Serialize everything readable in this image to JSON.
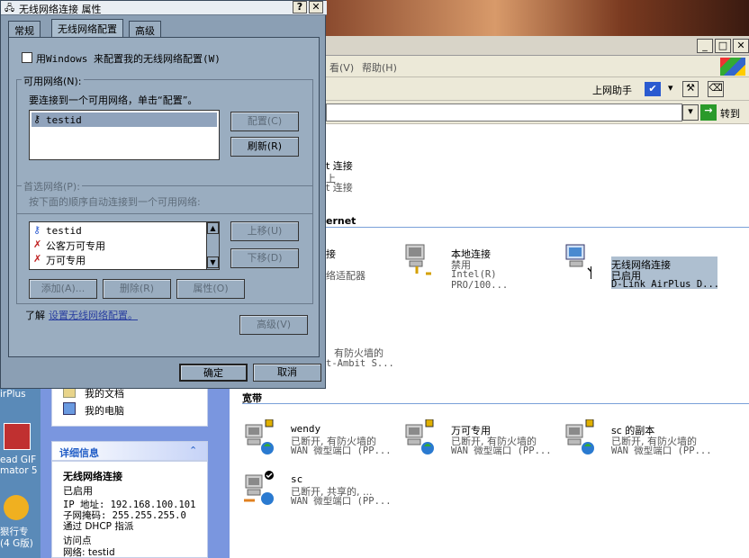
{
  "explorer": {
    "menu_help": "帮助(H)",
    "menu_view_fragment": "看(V)",
    "toolbar_helper": "上网助手",
    "go_label": "转到",
    "conn_fragment_title": "t 连接",
    "conn_fragment_line2": "上",
    "conn_fragment_line3": "t 连接",
    "section_internet": "ernet",
    "conn_fragment2_title": "接",
    "conn_fragment2_sub": "络适配器",
    "local": {
      "name": "本地连接",
      "status": "禁用",
      "device": "Intel(R) PRO/100..."
    },
    "wireless": {
      "name": "无线网络连接",
      "status": "已启用",
      "device": "D-Link AirPlus D..."
    },
    "firewall_frag": {
      "line1": "有防火墙的",
      "line2": "t-Ambit S..."
    },
    "section_broadband": "宽带",
    "broadband": [
      {
        "name": "wendy",
        "status": "已断开, 有防火墙的",
        "device": "WAN 微型端口 (PP..."
      },
      {
        "name": "万可专用",
        "status": "已断开, 有防火墙的",
        "device": "WAN 微型端口 (PP..."
      },
      {
        "name": "sc 的副本",
        "status": "已断开, 有防火墙的",
        "device": "WAN 微型端口 (PP..."
      },
      {
        "name": "sc",
        "status": "已断开, 共享的, ...",
        "device": "WAN 微型端口 (PP..."
      }
    ],
    "left_items": [
      "我的文档",
      "我的电脑"
    ],
    "details_title": "详细信息",
    "details": {
      "name": "无线网络连接",
      "status": "已启用",
      "ip": "IP 地址: 192.168.100.101",
      "mask": "子网掩码: 255.255.255.0",
      "dhcp": "通过 DHCP 指派",
      "ap": "访问点",
      "net": "网络: testid"
    },
    "desktop": {
      "a": "irPlus",
      "b": "ead GIF",
      "c": "mator 5",
      "d": "狠行专",
      "e": "(4 G版)"
    }
  },
  "dialog": {
    "title": "无线网络连接 属性",
    "tabs": [
      "常规",
      "无线网络配置",
      "高级"
    ],
    "use_windows": "用Windows 来配置我的无线网络配置(W)",
    "available_label": "可用网络(N):",
    "available_hint": "要连接到一个可用网络，单击“配置”。",
    "available_list": [
      "testid"
    ],
    "configure_btn": "配置(C)",
    "refresh_btn": "刷新(R)",
    "preferred_label": "首选网络(P):",
    "preferred_hint": "按下面的顺序自动连接到一个可用网络:",
    "preferred_list": [
      "testid",
      "公客万可专用",
      "万可专用"
    ],
    "up_btn": "上移(U)",
    "down_btn": "下移(D)",
    "add_btn": "添加(A)...",
    "remove_btn": "删除(R)",
    "props_btn": "属性(O)",
    "learn_prefix": "了解",
    "learn_link": "设置无线网络配置。",
    "advanced_btn": "高级(V)",
    "ok_btn": "确定",
    "cancel_btn": "取消",
    "help_glyph": "?",
    "close_glyph": "✕"
  },
  "colors": {
    "dialog_bg": "#8b9fb4",
    "link": "#2a3fa0",
    "go_green": "#2a9a2a"
  }
}
